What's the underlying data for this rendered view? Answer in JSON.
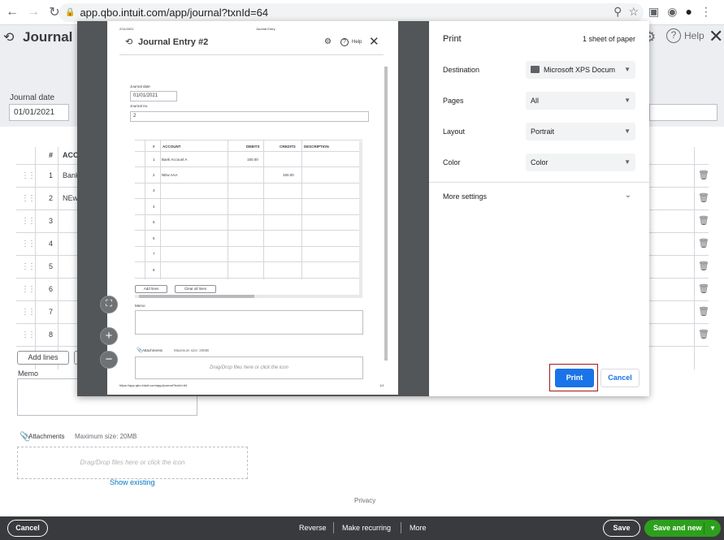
{
  "browser": {
    "url": "app.qbo.intuit.com/app/journal?txnId=64"
  },
  "background": {
    "title": "Journal E",
    "help": "Help",
    "journal_date_label": "Journal date",
    "journal_date": "01/01/2021",
    "table_headers": [
      "#",
      "ACCO"
    ],
    "rows": [
      {
        "num": "1",
        "account": "Bank"
      },
      {
        "num": "2",
        "account": "NEw"
      },
      {
        "num": "3",
        "account": ""
      },
      {
        "num": "4",
        "account": ""
      },
      {
        "num": "5",
        "account": ""
      },
      {
        "num": "6",
        "account": ""
      },
      {
        "num": "7",
        "account": ""
      },
      {
        "num": "8",
        "account": ""
      }
    ],
    "add_lines": "Add lines",
    "memo_label": "Memo",
    "attachments_label": "Attachments",
    "max_size": "Maximum size: 20MB",
    "drop_text": "Drag/Drop files here or click the icon",
    "show_existing": "Show existing",
    "privacy": "Privacy"
  },
  "footer": {
    "cancel": "Cancel",
    "reverse": "Reverse",
    "make_recurring": "Make recurring",
    "more": "More",
    "save": "Save",
    "save_and_new": "Save and new"
  },
  "preview": {
    "header_date": "2/11/2021",
    "header_title": "Journal Entry",
    "title": "Journal Entry #2",
    "help": "Help",
    "journal_date_label": "Journal date",
    "journal_date": "01/01/2021",
    "journal_no_label": "Journal no.",
    "journal_no": "2",
    "table_headers": {
      "num": "#",
      "account": "ACCOUNT",
      "debits": "DEBITS",
      "credits": "CREDITS",
      "description": "DESCRIPTION"
    },
    "rows": [
      {
        "num": "1",
        "account": "Bank Account A",
        "debit": "150.00",
        "credit": ""
      },
      {
        "num": "2",
        "account": "NEw AAA",
        "debit": "",
        "credit": "150.00"
      },
      {
        "num": "3",
        "account": "",
        "debit": "",
        "credit": ""
      },
      {
        "num": "4",
        "account": "",
        "debit": "",
        "credit": ""
      },
      {
        "num": "5",
        "account": "",
        "debit": "",
        "credit": ""
      },
      {
        "num": "6",
        "account": "",
        "debit": "",
        "credit": ""
      },
      {
        "num": "7",
        "account": "",
        "debit": "",
        "credit": ""
      },
      {
        "num": "8",
        "account": "",
        "debit": "",
        "credit": ""
      }
    ],
    "add_lines": "Add lines",
    "clear_all_lines": "Clear all lines",
    "memo_label": "Memo",
    "attachments_label": "Attachments",
    "max_size": "Maximum size: 20MB",
    "drop_text": "Drag/Drop files here or click the icon",
    "footer_url": "https://app.qbo.intuit.com/app/journal?txnId=64",
    "page_number": "1/1"
  },
  "print_settings": {
    "title": "Print",
    "sheets": "1 sheet of paper",
    "destination_label": "Destination",
    "destination_value": "Microsoft XPS Docum",
    "pages_label": "Pages",
    "pages_value": "All",
    "layout_label": "Layout",
    "layout_value": "Portrait",
    "color_label": "Color",
    "color_value": "Color",
    "more_settings": "More settings",
    "print_button": "Print",
    "cancel_button": "Cancel"
  },
  "colors": {
    "print_blue": "#1a73e8",
    "qbo_green": "#2ca01c",
    "footer_bg": "#393a3d",
    "highlight_border": "#a31818"
  }
}
